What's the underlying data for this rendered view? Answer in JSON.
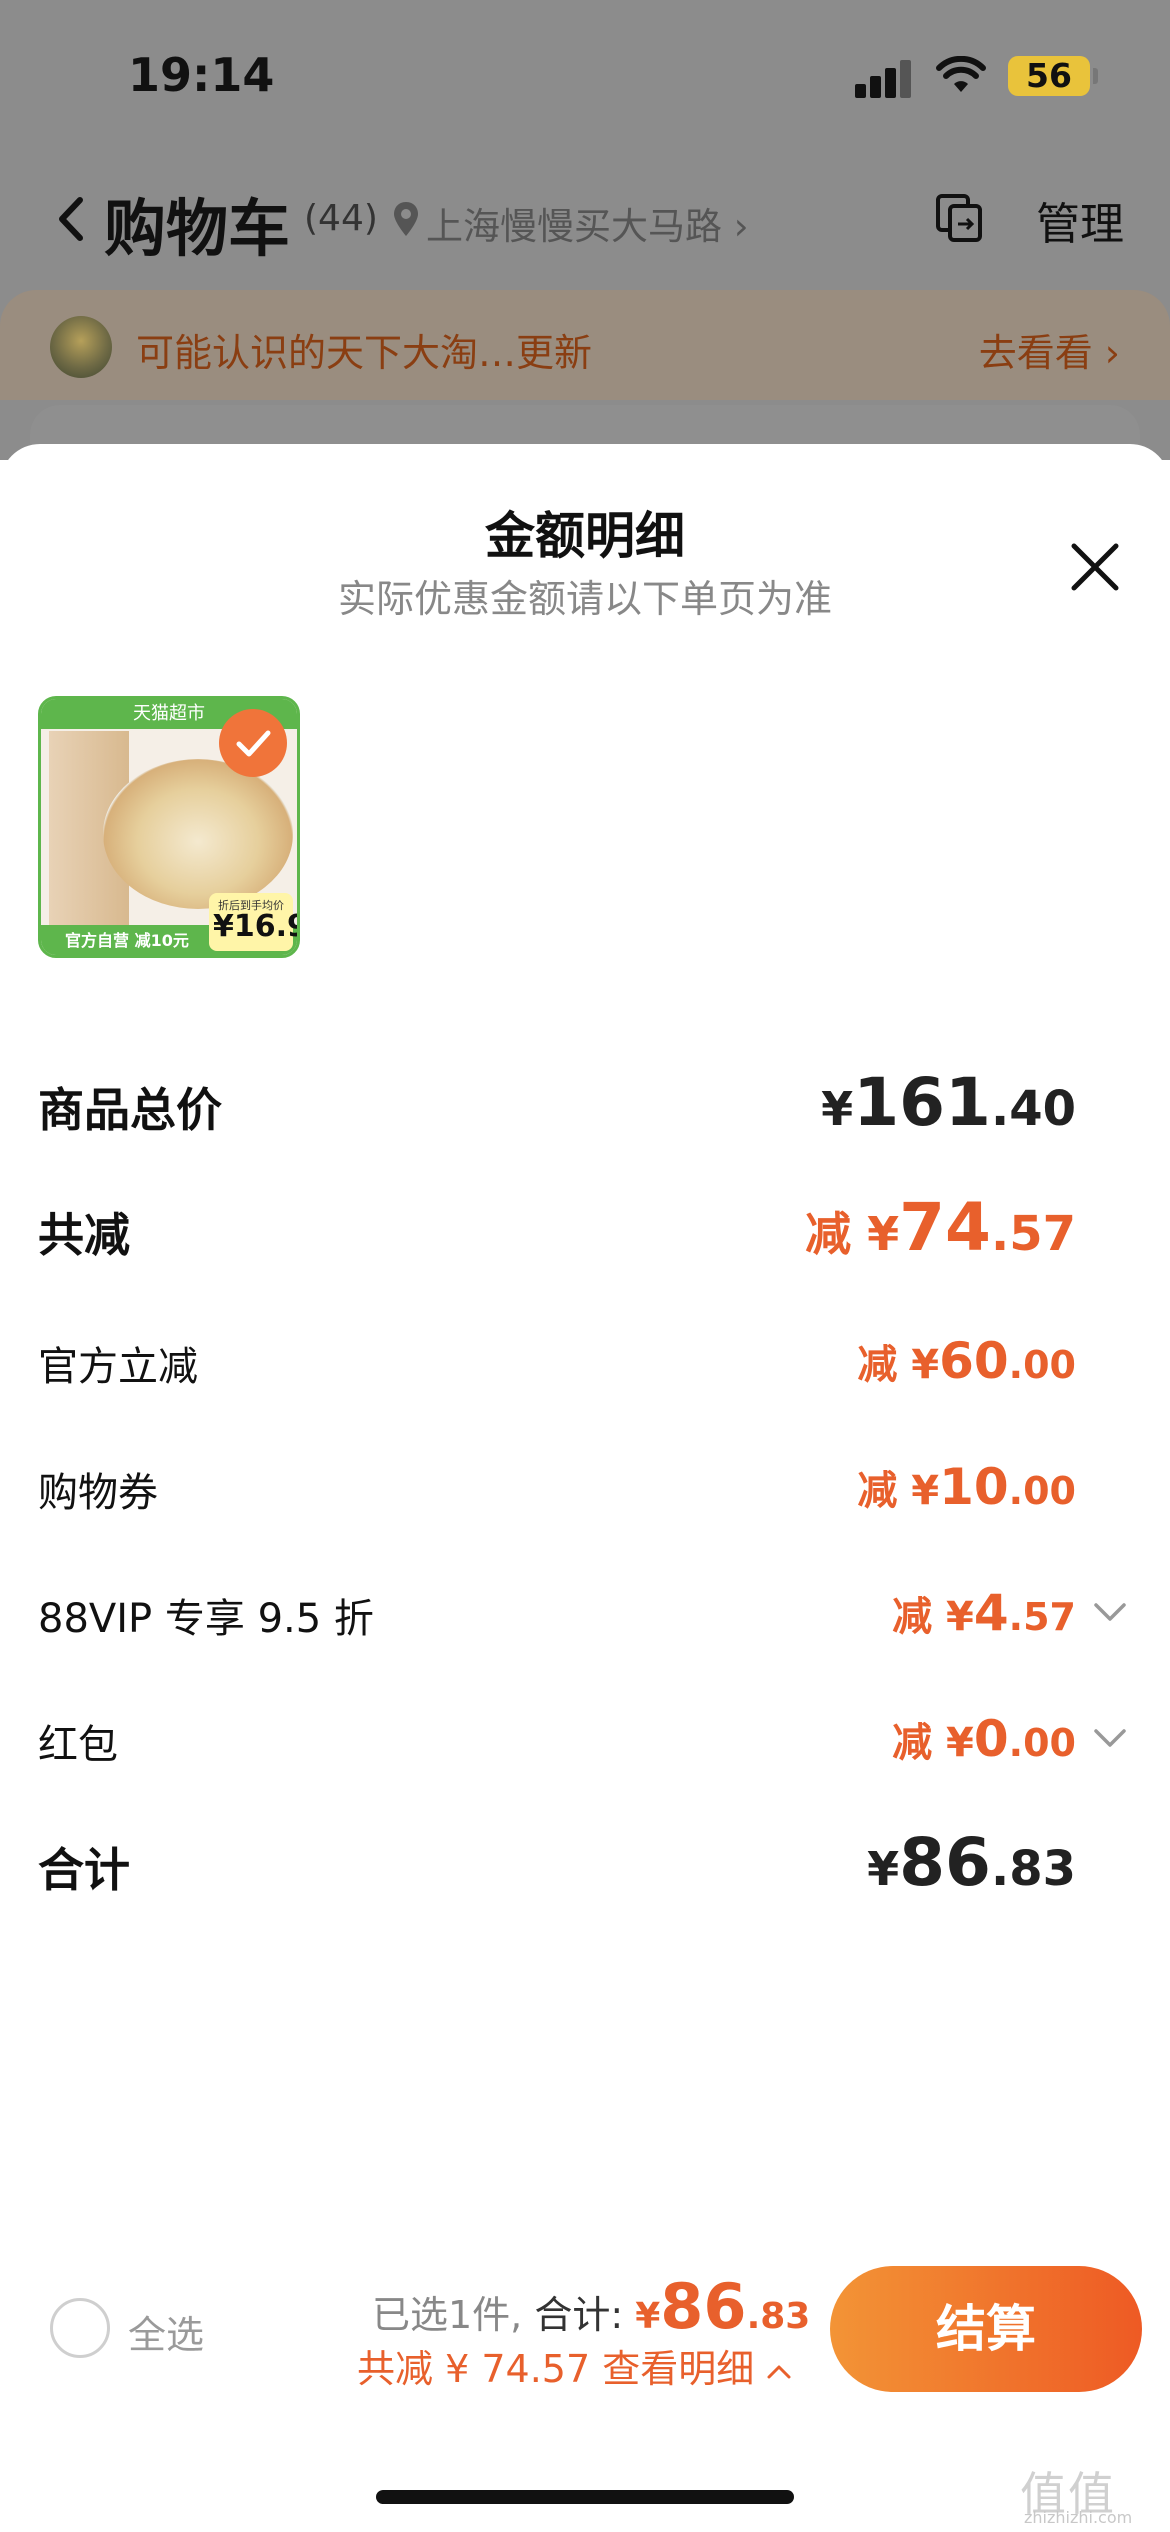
{
  "status_bar": {
    "time": "19:14",
    "battery": "56"
  },
  "nav": {
    "title": "购物车",
    "count": "(44)",
    "location": "上海慢慢买大马路 ›",
    "manage": "管理"
  },
  "notice": {
    "text": "可能认识的天下大淘…更新",
    "link": "去看看 ›"
  },
  "sheet": {
    "title": "金额明细",
    "subtitle": "实际优惠金额请以下单页为准",
    "product": {
      "top_label": "天猫超市",
      "bottom_label": "官方自营 减10元",
      "price_tag_label": "折后到手均价",
      "price_tag_value": "¥16.9"
    },
    "rows": [
      {
        "label": "商品总价",
        "prefix": "¥",
        "int": "161",
        "dec": ".40"
      },
      {
        "label": "共减",
        "prefix": "减 ¥",
        "int": "74",
        "dec": ".57"
      },
      {
        "label": "官方立减",
        "prefix": "减 ¥",
        "int": "60",
        "dec": ".00"
      },
      {
        "label": "购物券",
        "prefix": "减 ¥",
        "int": "10",
        "dec": ".00"
      },
      {
        "label": "88VIP 专享 9.5 折",
        "prefix": "减 ¥",
        "int": "4",
        "dec": ".57"
      },
      {
        "label": "红包",
        "prefix": "减 ¥",
        "int": "0",
        "dec": ".00"
      },
      {
        "label": "合计",
        "prefix": "¥",
        "int": "86",
        "dec": ".83"
      }
    ]
  },
  "bottom_bar": {
    "select_all": "全选",
    "selected": "已选1件, ",
    "total_label": "合计: ",
    "total_yuan": "¥",
    "total_int": "86",
    "total_dec": ".83",
    "discount": "共减 ¥ 74.57  查看明细",
    "checkout": "结算"
  },
  "watermark": {
    "mark": "值值值",
    "text": "zhizhizhi.com"
  },
  "colors": {
    "accent": "#e8602c",
    "button_start": "#f39436",
    "button_end": "#ee5a24"
  }
}
